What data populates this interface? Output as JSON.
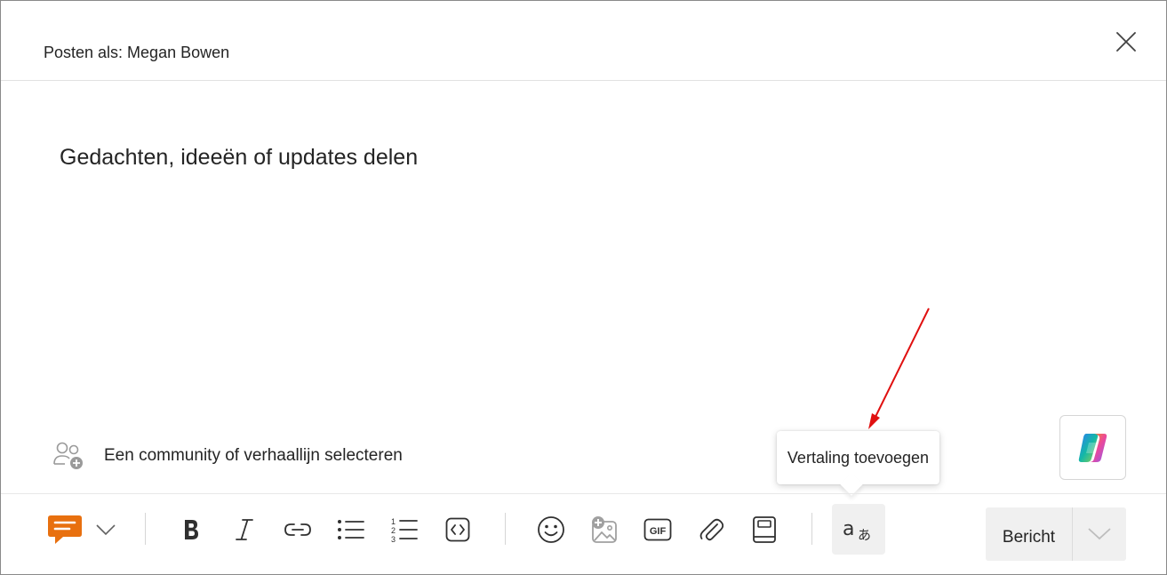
{
  "header": {
    "post_as": "Posten als: Megan Bowen",
    "close_icon": "close-icon"
  },
  "editor": {
    "placeholder": "Gedachten, ideeën of updates delen"
  },
  "community": {
    "label": "Een community of verhaallijn selecteren",
    "icon": "people-add-icon"
  },
  "tooltip": {
    "text": "Vertaling toevoegen"
  },
  "toolbar": {
    "items": [
      {
        "name": "post-type-button",
        "icon": "chat-bubble-icon"
      },
      {
        "name": "post-type-dropdown",
        "icon": "chevron-down-icon"
      },
      {
        "name": "bold-button",
        "icon": "bold-icon"
      },
      {
        "name": "italic-button",
        "icon": "italic-icon"
      },
      {
        "name": "link-button",
        "icon": "link-icon"
      },
      {
        "name": "bullet-list-button",
        "icon": "bullet-list-icon"
      },
      {
        "name": "numbered-list-button",
        "icon": "numbered-list-icon"
      },
      {
        "name": "code-button",
        "icon": "code-icon"
      },
      {
        "name": "emoji-button",
        "icon": "emoji-icon"
      },
      {
        "name": "image-button",
        "icon": "image-add-icon"
      },
      {
        "name": "gif-button",
        "icon": "gif-icon"
      },
      {
        "name": "attach-button",
        "icon": "paperclip-icon"
      },
      {
        "name": "notebook-button",
        "icon": "notebook-icon"
      },
      {
        "name": "translate-button",
        "icon": "translate-icon"
      }
    ],
    "send_label": "Bericht"
  },
  "colors": {
    "accent_orange": "#e8700f",
    "annotation_arrow": "#e01010",
    "text": "#242424",
    "icon": "#424242"
  }
}
